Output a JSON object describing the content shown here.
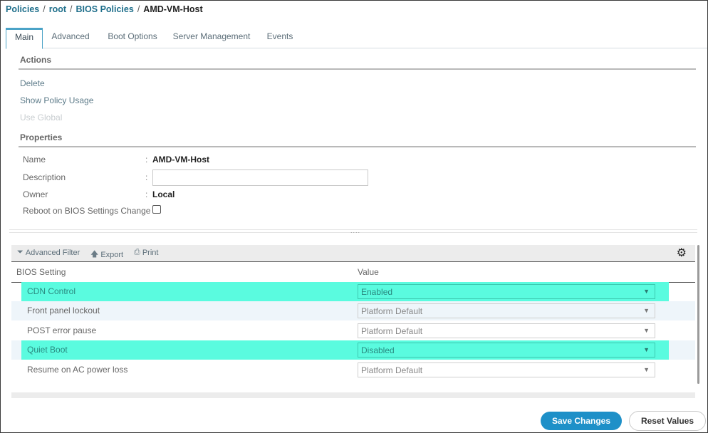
{
  "breadcrumb": {
    "items": [
      "Policies",
      "root",
      "BIOS Policies"
    ],
    "current": "AMD-VM-Host",
    "separator": "/"
  },
  "tabs": [
    {
      "label": "Main",
      "active": true
    },
    {
      "label": "Advanced",
      "active": false
    },
    {
      "label": "Boot Options",
      "active": false
    },
    {
      "label": "Server Management",
      "active": false
    },
    {
      "label": "Events",
      "active": false
    }
  ],
  "actions": {
    "title": "Actions",
    "items": [
      {
        "label": "Delete",
        "enabled": true
      },
      {
        "label": "Show Policy Usage",
        "enabled": true
      },
      {
        "label": "Use Global",
        "enabled": false
      }
    ]
  },
  "properties": {
    "title": "Properties",
    "name_label": "Name",
    "name_value": "AMD-VM-Host",
    "description_label": "Description",
    "description_value": "",
    "owner_label": "Owner",
    "owner_value": "Local",
    "reboot_label": "Reboot on BIOS Settings Change",
    "reboot_checked": false,
    "colon": ":"
  },
  "splitter": {
    "handle": "...."
  },
  "toolbar": {
    "advanced_filter": "Advanced Filter",
    "export": "Export",
    "print": "Print",
    "icons": {
      "filter": "filter-icon",
      "export": "arrow-up-icon",
      "print": "printer-icon",
      "settings": "gear-icon"
    }
  },
  "table": {
    "columns": [
      "BIOS Setting",
      "Value"
    ],
    "rows": [
      {
        "setting": "CDN Control",
        "value": "Enabled",
        "highlighted": true
      },
      {
        "setting": "Front panel lockout",
        "value": "Platform Default",
        "highlighted": false
      },
      {
        "setting": "POST error pause",
        "value": "Platform Default",
        "highlighted": false
      },
      {
        "setting": "Quiet Boot",
        "value": "Disabled",
        "highlighted": true
      },
      {
        "setting": "Resume on AC power loss",
        "value": "Platform Default",
        "highlighted": false
      }
    ]
  },
  "buttons": {
    "save": "Save Changes",
    "reset": "Reset Values"
  },
  "colors": {
    "link": "#1f6f8b",
    "highlight": "#5afbdf",
    "primary_button": "#1e90c8",
    "active_tab_border": "#4ba3c7"
  }
}
